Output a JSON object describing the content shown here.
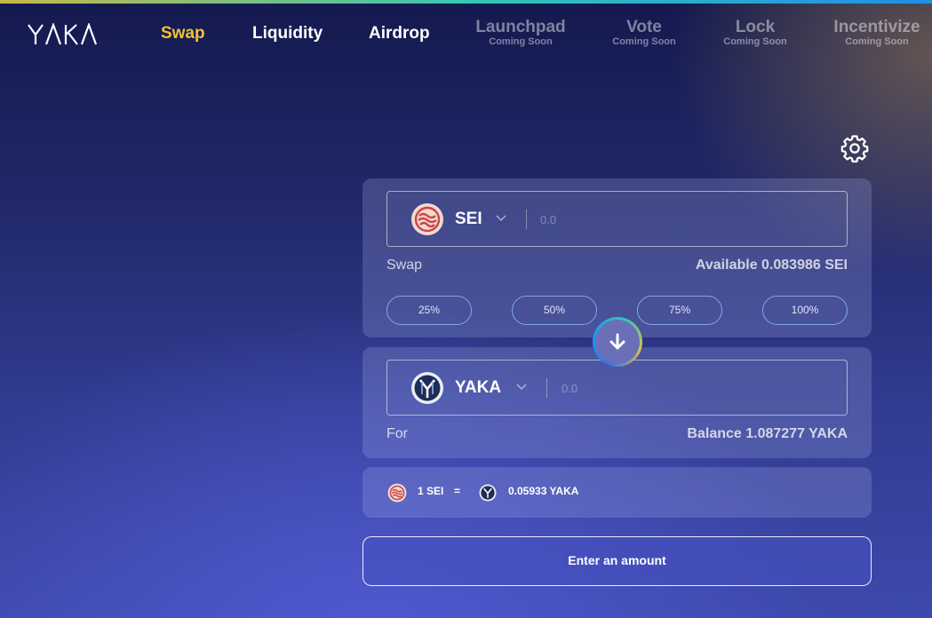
{
  "colors": {
    "accent_active": "#f2c230",
    "sei_red": "#c8454a",
    "yaka_dark": "#1e2d55",
    "pct_border": "#8cb4ff"
  },
  "nav": {
    "logo_text": "YAKA",
    "items": [
      {
        "label": "Swap",
        "active": true
      },
      {
        "label": "Liquidity",
        "active": false
      },
      {
        "label": "Airdrop",
        "active": false
      }
    ],
    "coming_soon": [
      {
        "label": "Launchpad",
        "sub": "Coming Soon"
      },
      {
        "label": "Vote",
        "sub": "Coming Soon"
      },
      {
        "label": "Lock",
        "sub": "Coming Soon"
      },
      {
        "label": "Incentivize",
        "sub": "Coming Soon"
      }
    ]
  },
  "settings_icon": "gear-icon",
  "from": {
    "token": "SEI",
    "token_icon": "sei-token-icon",
    "placeholder": "0.0",
    "label": "Swap",
    "available": "Available 0.083986 SEI",
    "percents": [
      "25%",
      "50%",
      "75%",
      "100%"
    ]
  },
  "switch_icon": "arrow-down-icon",
  "to": {
    "token": "YAKA",
    "token_icon": "yaka-token-icon",
    "placeholder": "0.0",
    "label": "For",
    "balance": "Balance 1.087277 YAKA"
  },
  "rate": {
    "from": "1 SEI",
    "equals": "=",
    "to": "0.05933 YAKA"
  },
  "action_button": "Enter an amount"
}
